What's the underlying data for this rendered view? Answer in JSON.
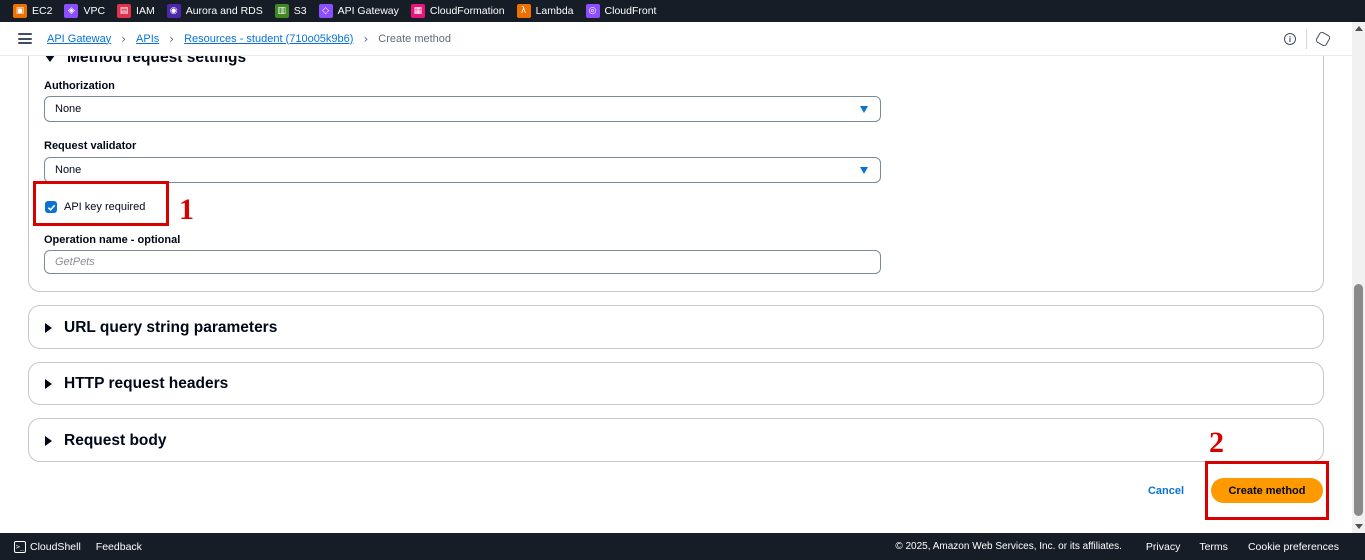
{
  "favorites": [
    {
      "label": "EC2",
      "icon": "ec2-icon",
      "color": "#ed7100",
      "glyph": "▣"
    },
    {
      "label": "VPC",
      "icon": "vpc-icon",
      "color": "#8c4fff",
      "glyph": "◈"
    },
    {
      "label": "IAM",
      "icon": "iam-icon",
      "color": "#dd344c",
      "glyph": "▤"
    },
    {
      "label": "Aurora and RDS",
      "icon": "rds-icon",
      "color": "#4d27aa",
      "glyph": "◉"
    },
    {
      "label": "S3",
      "icon": "s3-icon",
      "color": "#3f8624",
      "glyph": "▥"
    },
    {
      "label": "API Gateway",
      "icon": "api-gateway-icon",
      "color": "#8c4fff",
      "glyph": "◇"
    },
    {
      "label": "CloudFormation",
      "icon": "cloudformation-icon",
      "color": "#e7157b",
      "glyph": "▦"
    },
    {
      "label": "Lambda",
      "icon": "lambda-icon",
      "color": "#ed7100",
      "glyph": "λ"
    },
    {
      "label": "CloudFront",
      "icon": "cloudfront-icon",
      "color": "#8c4fff",
      "glyph": "◎"
    }
  ],
  "breadcrumbs": {
    "items": [
      "API Gateway",
      "APIs",
      "Resources - student (710o05k9b6)"
    ],
    "current": "Create method"
  },
  "sections": {
    "method_request": {
      "title": "Method request settings",
      "authorization_label": "Authorization",
      "authorization_value": "None",
      "validator_label": "Request validator",
      "validator_value": "None",
      "api_key_label": "API key required",
      "api_key_checked": true,
      "operation_label": "Operation name - optional",
      "operation_placeholder": "GetPets"
    },
    "url_query": {
      "title": "URL query string parameters"
    },
    "http_headers": {
      "title": "HTTP request headers"
    },
    "request_body": {
      "title": "Request body"
    }
  },
  "actions": {
    "cancel_label": "Cancel",
    "create_label": "Create method"
  },
  "annotations": {
    "step1": "1",
    "step2": "2",
    "color": "#d90000"
  },
  "footer": {
    "cloudshell": "CloudShell",
    "feedback": "Feedback",
    "copyright": "© 2025, Amazon Web Services, Inc. or its affiliates.",
    "privacy": "Privacy",
    "terms": "Terms",
    "cookies": "Cookie preferences"
  },
  "colors": {
    "accent": "#0972d3",
    "primary_button": "#ff9900",
    "nav_bg": "#161d26"
  }
}
